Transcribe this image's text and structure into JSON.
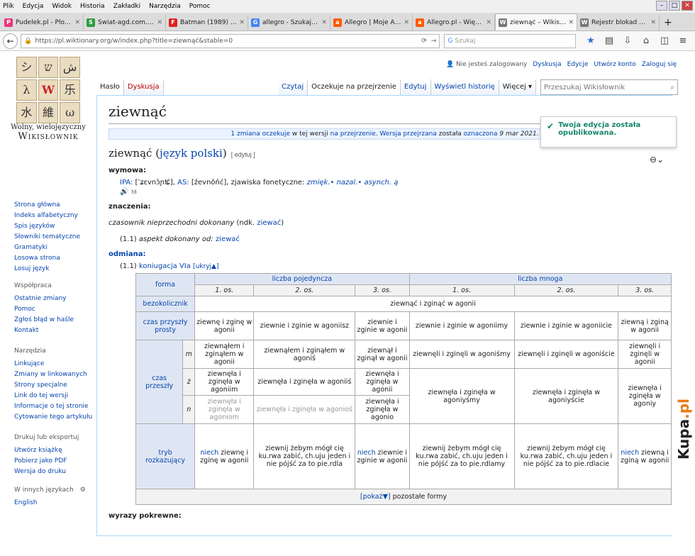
{
  "menu": [
    "Plik",
    "Edycja",
    "Widok",
    "Historia",
    "Zakładki",
    "Narzędzia",
    "Pomoc"
  ],
  "tabs": [
    {
      "title": "Pudelek.pl - Plotki...",
      "color": "#e8367e",
      "g": "P"
    },
    {
      "title": "Swiat-agd.com.pl...",
      "color": "#2b9c3f",
      "g": "S"
    },
    {
      "title": "Batman (1989) - ...",
      "color": "#d22",
      "g": "F"
    },
    {
      "title": "allegro - Szukaj w...",
      "color": "#4285f4",
      "g": "G"
    },
    {
      "title": "Allegro | Moje All...",
      "color": "#ff5a00",
      "g": "a"
    },
    {
      "title": "Allegro.pl - Więce...",
      "color": "#ff5a00",
      "g": "a"
    },
    {
      "title": "ziewnąć – Wikisło...",
      "color": "#777",
      "g": "W"
    },
    {
      "title": "Rejestr blokad – ...",
      "color": "#777",
      "g": "W"
    }
  ],
  "url": "https://pl.wiktionary.org/w/index.php?title=ziewnąć&stable=0",
  "search_placeholder": "Szukaj",
  "logo": {
    "line1": "Wolny, wielojęzyczny",
    "line2": "Wikisłownik",
    "glyphs": [
      "シ",
      "ש",
      "ش",
      "λ",
      "W",
      "乐",
      "水",
      "維",
      "ω"
    ]
  },
  "nav": [
    "Strona główna",
    "Indeks alfabetyczny",
    "Spis języków",
    "Słowniki tematyczne",
    "Gramatyki",
    "Losowa strona",
    "Losuj język"
  ],
  "wspolpraca": {
    "title": "Współpraca",
    "items": [
      "Ostatnie zmiany",
      "Pomoc",
      "Zgłoś błąd w haśle",
      "Kontakt"
    ]
  },
  "narzedzia": {
    "title": "Narzędzia",
    "items": [
      "Linkujące",
      "Zmiany w linkowanych",
      "Strony specjalne",
      "Link do tej wersji",
      "Informacje o tej stronie",
      "Cytowanie tego artykułu"
    ]
  },
  "druk": {
    "title": "Drukuj lub eksportuj",
    "items": [
      "Utwórz książkę",
      "Pobierz jako PDF",
      "Wersja do druku"
    ]
  },
  "inne": {
    "title": "W innych językach",
    "items": [
      "English"
    ]
  },
  "personal": {
    "user": "Nie jesteś zalogowany",
    "items": [
      "Dyskusja",
      "Edycje",
      "Utwórz konto",
      "Zaloguj się"
    ]
  },
  "vtabs": {
    "haslo": "Hasło",
    "dyskusja": "Dyskusja",
    "czytaj": "Czytaj",
    "oczekuje": "Oczekuje na przejrzenie",
    "edytuj": "Edytuj",
    "historia": "Wyświetl historię",
    "wiecej": "Więcej ▾",
    "search": "Przeszukaj Wikisłownik"
  },
  "title": "ziewnąć",
  "flagged": {
    "a": "1 zmiana oczekuje",
    "b": " w tej wersji ",
    "c": "na przejrzenie",
    "d": ". ",
    "e": "Wersja przejrzana",
    "f": " została ",
    "g": "oznaczona",
    "h": " 9 mar 2021."
  },
  "notif": "Twoja edycja została opublikowana.",
  "h2": {
    "word": "ziewnąć (",
    "lang": "język polski",
    "close": ")",
    "edit": "[ edytuj ]"
  },
  "wymowa": {
    "label": "wymowa:",
    "ipa": "IPA:",
    "ipa_val": " [ˈʑɛvnɔ̃ɲʨ̑], ",
    "as": "AS:",
    "as_val": " [źevnõńć], zjawiska fonetyczne: ",
    "fx": "zmięk.• nazal.• asynch. ą",
    "audio": "?/i"
  },
  "znaczenia": {
    "label": "znaczenia:",
    "pos": "czasownik nieprzechodni dokonany",
    "ndk": " (ndk. ",
    "ndk_link": "ziewać",
    "close": ")",
    "def_num": "(1.1) ",
    "def": "aspekt dokonany od: ",
    "def_link": "ziewać"
  },
  "odmiana": {
    "label": "odmiana:",
    "num": "(1.1) ",
    "link": "koniugacja VIa",
    "toggle": "[ukryj▲]"
  },
  "table": {
    "forma": "forma",
    "poj": "liczba pojedyncza",
    "mn": "liczba mnoga",
    "os": [
      "1. os.",
      "2. os.",
      "3. os.",
      "1. os.",
      "2. os.",
      "3. os."
    ],
    "bez": "bezokolicznik",
    "bez_val": "ziewnąć i zginąć w agonii",
    "cps": "czas przyszły prosty",
    "cps_vals": [
      "ziewnę i zginę w agonii",
      "ziewnie i zginie w agoniisz",
      "ziewnie i zginie w agonii",
      "ziewnie i zginie w agoniimy",
      "ziewnie i zginie w agoniicie",
      "ziewną i zginą w agonii"
    ],
    "cp": "czas przeszły",
    "m": "m",
    "z": "ż",
    "n": "n",
    "cp_m": [
      "ziewnąłem i zginąłem w agonii",
      "ziewnąłem i zginąłem w agoniś",
      "ziewnął i zginął w agonii",
      "ziewnęli i zginęli w agoniśmy",
      "ziewnęli i zginęli w agoniście",
      "ziewnęli i zginęli w agonii"
    ],
    "cp_z": [
      "ziewnęła i zginęła w agoniim",
      "ziewnęła i zginęła w agoniiś",
      "ziewnęła i zginęła w agonii"
    ],
    "cp_n": [
      "ziewnęła i zginęła w agoniom",
      "ziewnęła i zginęła w agonioś",
      "ziewnęła i zginęła w agonio"
    ],
    "cp_pl": [
      "ziewnęła i zginęła w agoniyśmy",
      "ziewnęła i zginęła w agoniyście",
      "ziewnęła i zginęła w agoniy"
    ],
    "tryb": "tryb rozkazujący",
    "niech": "niech",
    "tr": [
      " ziewnę i zginę w agonii",
      "ziewnij żebym mógł cię ku.rwa zabić, ch.uju jeden i nie pójść za to pie.rdla",
      " ziewnie i zginie w agonii",
      "ziewnij żebym mógł cię ku.rwa zabić, ch.uju jeden i nie pójść za to pie.rdlamy",
      "ziewnij żebym mógł cię ku.rwa zabić, ch.uju jeden i nie pójść za to pie.rdlacie",
      " ziewną i zginą w agonii"
    ],
    "pokaz": "[pokaż▼]",
    "pozostale": " pozostałe formy"
  },
  "pokrewne": "wyrazy pokrewne:",
  "watermark": {
    "a": "Kupa",
    ".pl": ".pl"
  }
}
